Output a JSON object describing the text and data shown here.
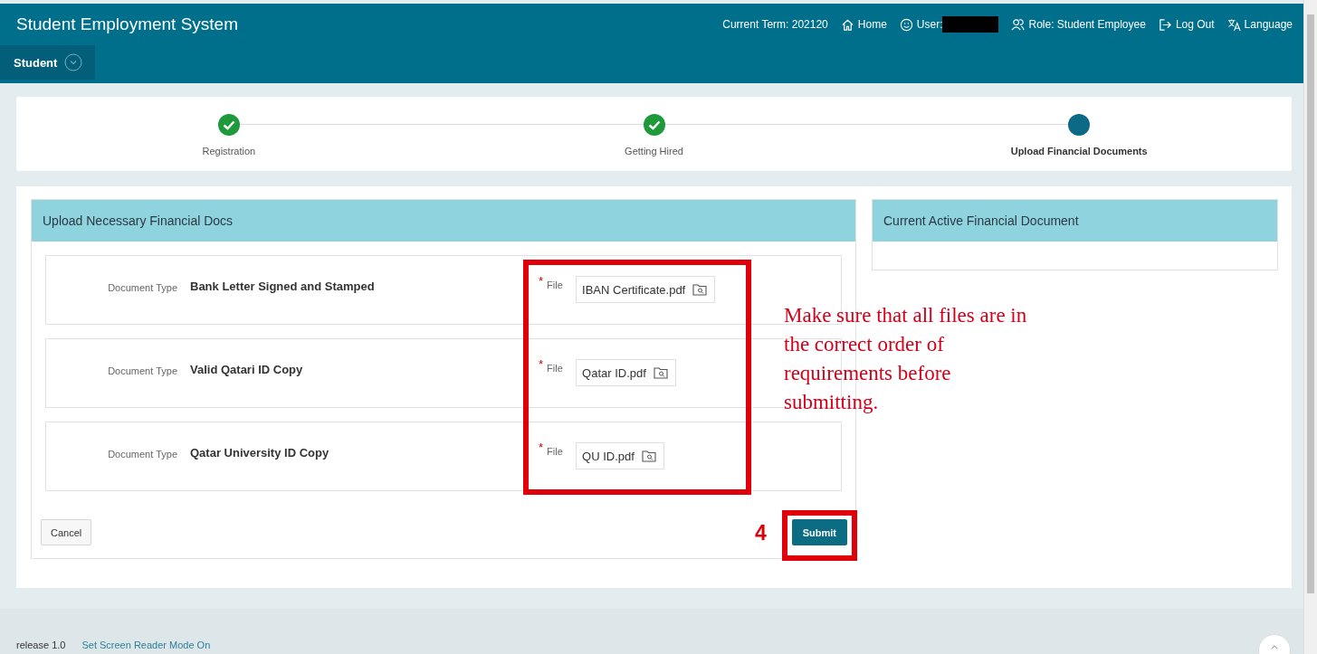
{
  "app_title": "Student Employment System",
  "header_links": [
    {
      "kind": "term",
      "label": "Current Term: 202120"
    },
    {
      "kind": "home",
      "label": "Home"
    },
    {
      "kind": "user",
      "label": "User:",
      "redacted": true
    },
    {
      "kind": "role",
      "label": "Role: Student Employee"
    },
    {
      "kind": "logout",
      "label": "Log Out"
    },
    {
      "kind": "language",
      "label": "Language"
    }
  ],
  "nav": {
    "label": "Student"
  },
  "steps": [
    {
      "label": "Registration",
      "completed": true
    },
    {
      "label": "Getting Hired",
      "completed": true
    },
    {
      "label": "Upload Financial Documents",
      "completed": false
    }
  ],
  "upload_region": {
    "title": "Upload Necessary Financial Docs",
    "documents": [
      {
        "type_label": "Document Type",
        "type": "Bank Letter Signed and Stamped",
        "required_mark": "*",
        "file_label": "File",
        "file": "IBAN Certificate.pdf"
      },
      {
        "type_label": "Document Type",
        "type": "Valid Qatari ID Copy",
        "required_mark": "*",
        "file_label": "File",
        "file": "Qatar ID.pdf"
      },
      {
        "type_label": "Document Type",
        "type": "Qatar University ID Copy",
        "required_mark": "*",
        "file_label": "File",
        "file": "QU ID.pdf"
      }
    ],
    "cancel": "Cancel",
    "submit": "Submit"
  },
  "active_region": {
    "title": "Current Active Financial Document"
  },
  "annotation": {
    "note": "Make sure that all files are in the correct order of requirements before submitting.",
    "step_number": "4"
  },
  "footer": {
    "release": "release 1.0",
    "screen_reader_link": "Set Screen Reader Mode On"
  }
}
